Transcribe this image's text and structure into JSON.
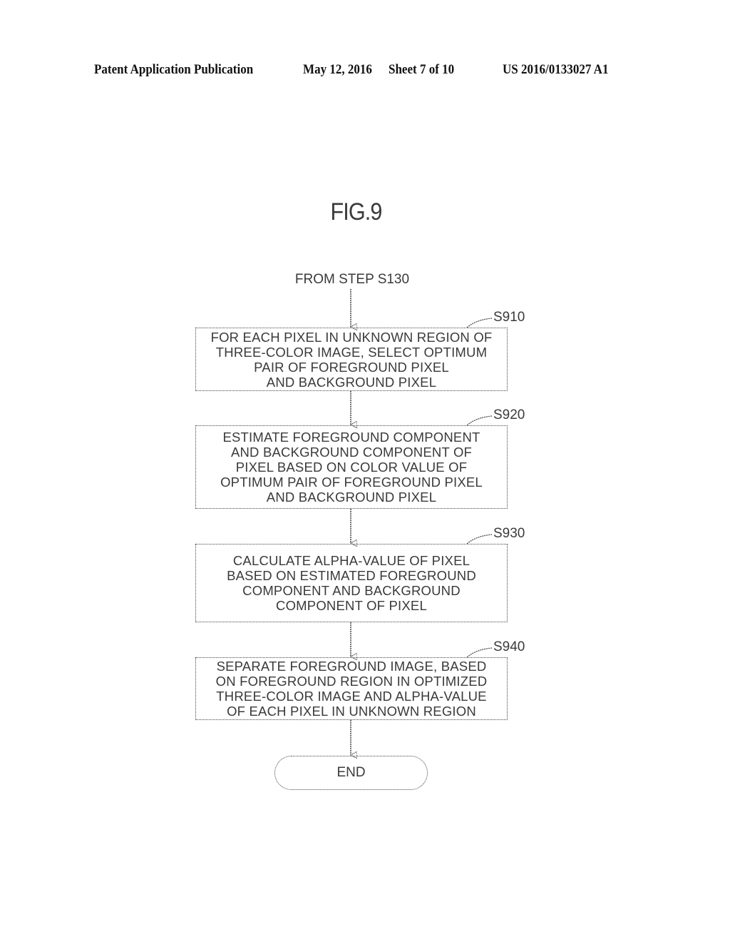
{
  "header": {
    "publication_type": "Patent Application Publication",
    "date": "May 12, 2016",
    "sheet": "Sheet 7 of 10",
    "patent_number": "US 2016/0133027 A1"
  },
  "figure": {
    "title": "FIG.9",
    "entry_label": "FROM STEP S130",
    "steps": [
      {
        "id": "S910",
        "lines": [
          "FOR EACH PIXEL IN UNKNOWN REGION OF",
          "THREE-COLOR IMAGE, SELECT OPTIMUM",
          "PAIR OF FOREGROUND PIXEL",
          "AND BACKGROUND PIXEL"
        ]
      },
      {
        "id": "S920",
        "lines": [
          "ESTIMATE FOREGROUND COMPONENT",
          "AND BACKGROUND COMPONENT OF",
          "PIXEL BASED ON COLOR VALUE OF",
          "OPTIMUM PAIR OF FOREGROUND PIXEL",
          "AND BACKGROUND PIXEL"
        ]
      },
      {
        "id": "S930",
        "lines": [
          "CALCULATE ALPHA-VALUE OF PIXEL",
          "BASED ON ESTIMATED FOREGROUND",
          "COMPONENT AND BACKGROUND",
          "COMPONENT OF PIXEL"
        ]
      },
      {
        "id": "S940",
        "lines": [
          "SEPARATE FOREGROUND IMAGE, BASED",
          "ON FOREGROUND REGION IN OPTIMIZED",
          "THREE-COLOR IMAGE AND ALPHA-VALUE",
          "OF EACH PIXEL IN UNKNOWN REGION"
        ]
      }
    ],
    "end_label": "END"
  }
}
